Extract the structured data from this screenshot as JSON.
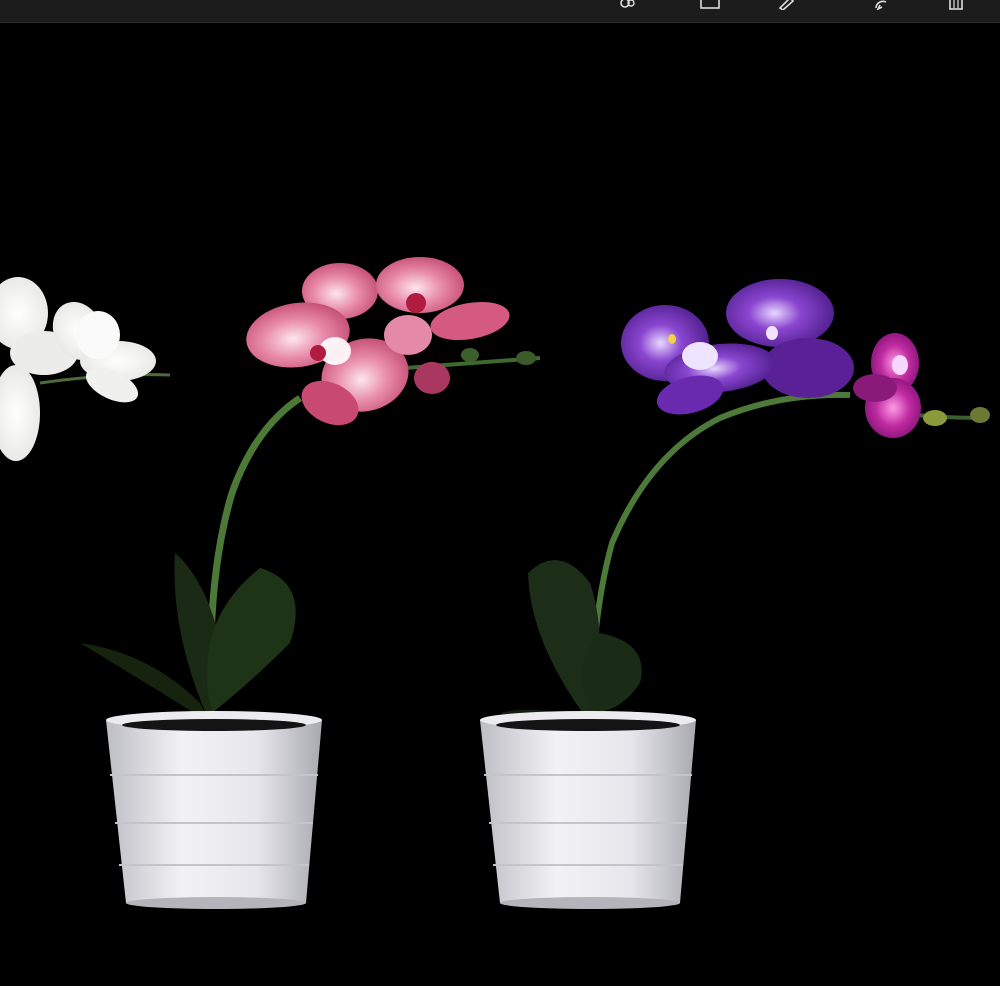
{
  "toolbar": {
    "tools": [
      {
        "name": "people-icon"
      },
      {
        "name": "frame-icon"
      },
      {
        "name": "edit-icon"
      },
      {
        "name": "rotate-icon"
      },
      {
        "name": "delete-icon"
      }
    ]
  },
  "photo": {
    "subject": "orchid-lamps",
    "colors": {
      "background": "#000000",
      "white_orchid": "#f4f4f2",
      "pink_orchid": "#e06a92",
      "purple_orchid": "#7a2bb8",
      "magenta_orchid": "#b0208a",
      "stem": "#4f7a3a",
      "pot": "#e8e8ec"
    }
  }
}
